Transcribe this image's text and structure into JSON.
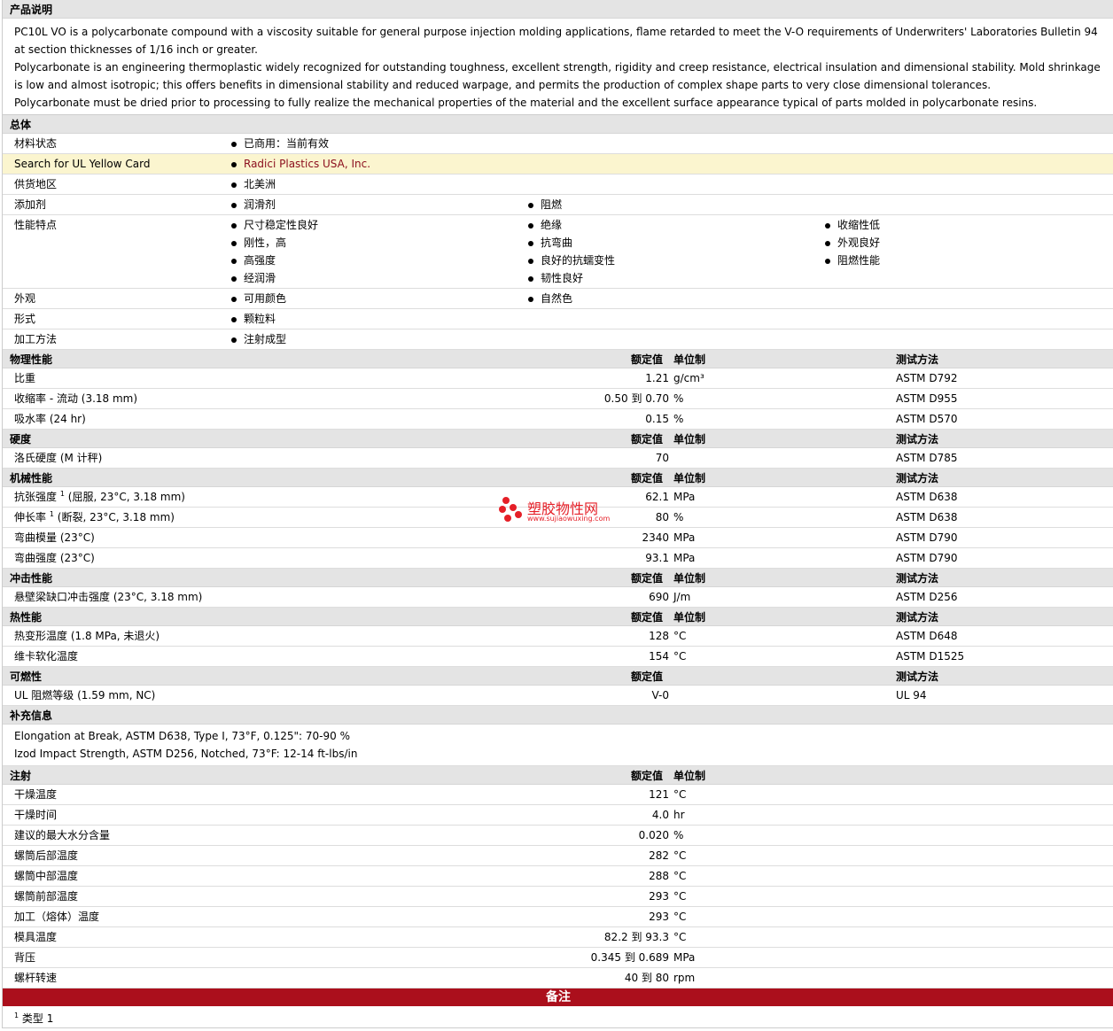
{
  "product": {
    "heading": "产品说明",
    "paragraphs": [
      "PC10L VO is a polycarbonate compound with a viscosity suitable for general purpose injection molding applications, flame retarded to meet the V-O requirements of Underwriters' Laboratories Bulletin 94 at section thicknesses of 1/16 inch or greater.",
      "Polycarbonate is an engineering thermoplastic widely recognized for outstanding toughness, excellent strength, rigidity and creep resistance, electrical insulation and dimensional stability. Mold shrinkage is low and almost isotropic; this offers benefits in dimensional stability and reduced warpage, and permits the production of complex shape parts to very close dimensional tolerances.",
      "Polycarbonate must be dried prior to processing to fully realize the mechanical properties of the material and the excellent surface appearance typical of parts molded in polycarbonate resins."
    ]
  },
  "general": {
    "heading": "总体",
    "rows": [
      {
        "label": "材料状态",
        "cols": [
          [
            "已商用：当前有效"
          ]
        ]
      },
      {
        "label": "Search for UL Yellow Card",
        "cols": [
          [
            "Radici Plastics USA, Inc."
          ]
        ]
      },
      {
        "label": "供货地区",
        "cols": [
          [
            "北美洲"
          ]
        ]
      },
      {
        "label": "添加剂",
        "cols": [
          [
            "润滑剂"
          ],
          [
            "阻燃"
          ]
        ]
      },
      {
        "label": "性能特点",
        "cols": [
          [
            "尺寸稳定性良好",
            "刚性，高",
            "高强度",
            "经润滑"
          ],
          [
            "绝缘",
            "抗弯曲",
            "良好的抗蠕变性",
            "韧性良好"
          ],
          [
            "收缩性低",
            "外观良好",
            "阻燃性能"
          ]
        ]
      },
      {
        "label": "外观",
        "cols": [
          [
            "可用颜色"
          ],
          [
            "自然色"
          ]
        ]
      },
      {
        "label": "形式",
        "cols": [
          [
            "颗粒料"
          ]
        ]
      },
      {
        "label": "加工方法",
        "cols": [
          [
            "注射成型"
          ]
        ]
      }
    ]
  },
  "col_labels": {
    "value": "额定值",
    "unit": "单位制",
    "test": "测试方法"
  },
  "physical": {
    "heading": "物理性能",
    "rows": [
      {
        "label": "比重",
        "value": "1.21",
        "unit": "g/cm³",
        "test": "ASTM D792"
      },
      {
        "label": "收缩率  - 流动  (3.18 mm)",
        "value": "0.50 到  0.70",
        "unit": "%",
        "test": "ASTM D955"
      },
      {
        "label": "吸水率  (24 hr)",
        "value": "0.15",
        "unit": "%",
        "test": "ASTM D570"
      }
    ]
  },
  "hardness": {
    "heading": "硬度",
    "rows": [
      {
        "label": "洛氏硬度  (M 计秤)",
        "value": "70",
        "unit": "",
        "test": "ASTM D785"
      }
    ]
  },
  "mechanical": {
    "heading": "机械性能",
    "rows": [
      {
        "label": "抗张强度",
        "sup": "1",
        "label2": "(屈服, 23°C, 3.18 mm)",
        "value": "62.1",
        "unit": "MPa",
        "test": "ASTM D638"
      },
      {
        "label": "伸长率",
        "sup": "1",
        "label2": "(断裂, 23°C, 3.18 mm)",
        "value": "80",
        "unit": "%",
        "test": "ASTM D638"
      },
      {
        "label": "弯曲模量  (23°C)",
        "value": "2340",
        "unit": "MPa",
        "test": "ASTM D790"
      },
      {
        "label": "弯曲强度  (23°C)",
        "value": "93.1",
        "unit": "MPa",
        "test": "ASTM D790"
      }
    ]
  },
  "impact": {
    "heading": "冲击性能",
    "rows": [
      {
        "label": "悬壁梁缺口冲击强度  (23°C, 3.18 mm)",
        "value": "690",
        "unit": "J/m",
        "test": "ASTM D256"
      }
    ]
  },
  "thermal": {
    "heading": "热性能",
    "rows": [
      {
        "label": "热变形温度  (1.8 MPa, 未退火)",
        "value": "128",
        "unit": "°C",
        "test": "ASTM D648"
      },
      {
        "label": "维卡软化温度",
        "value": "154",
        "unit": "°C",
        "test": "ASTM D1525"
      }
    ]
  },
  "flammability": {
    "heading": "可燃性",
    "rows": [
      {
        "label": "UL 阻燃等级  (1.59 mm, NC)",
        "value": "V-0",
        "unit": "",
        "test": "UL 94"
      }
    ]
  },
  "supplement": {
    "heading": "补充信息",
    "lines": [
      "Elongation at Break, ASTM D638, Type I, 73°F, 0.125\": 70-90 %",
      "Izod Impact Strength, ASTM D256, Notched, 73°F: 12-14 ft-lbs/in"
    ]
  },
  "injection": {
    "heading": "注射",
    "rows": [
      {
        "label": "干燥温度",
        "value": "121",
        "unit": "°C"
      },
      {
        "label": "干燥时间",
        "value": "4.0",
        "unit": "hr"
      },
      {
        "label": "建议的最大水分含量",
        "value": "0.020",
        "unit": "%"
      },
      {
        "label": "螺筒后部温度",
        "value": "282",
        "unit": "°C"
      },
      {
        "label": "螺筒中部温度",
        "value": "288",
        "unit": "°C"
      },
      {
        "label": "螺筒前部温度",
        "value": "293",
        "unit": "°C"
      },
      {
        "label": "加工（熔体）温度",
        "value": "293",
        "unit": "°C"
      },
      {
        "label": "模具温度",
        "value": "82.2 到  93.3",
        "unit": "°C"
      },
      {
        "label": "背压",
        "value": "0.345 到  0.689",
        "unit": "MPa"
      },
      {
        "label": "螺杆转速",
        "value": "40 到  80",
        "unit": "rpm"
      }
    ]
  },
  "notes": {
    "heading": "备注",
    "footnote_num": "1",
    "footnote_text": "类型  1"
  },
  "watermark": {
    "title": "塑胶物性网",
    "url": "www.sujiaowuxing.com"
  }
}
